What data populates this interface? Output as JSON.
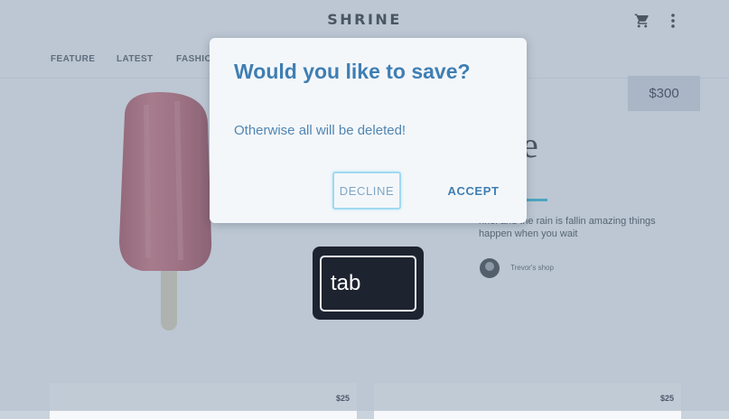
{
  "app": {
    "title": "SHRINE",
    "tabs": [
      "FEATURE",
      "LATEST",
      "FASHION"
    ]
  },
  "product": {
    "price": "$300",
    "title_glyph": "e",
    "description": "nnel and the rain is fallin amazing things happen when you wait",
    "shop_name": "Trevor's shop"
  },
  "cards": [
    {
      "price": "$25"
    },
    {
      "price": "$25"
    }
  ],
  "dialog": {
    "title": "Would you like to save?",
    "body": "Otherwise all will be deleted!",
    "decline_label": "DECLINE",
    "accept_label": "ACCEPT"
  },
  "key_overlay": {
    "label": "tab"
  },
  "icons": {
    "cart": "cart-icon",
    "more": "more-vert-icon"
  },
  "colors": {
    "accent": "#3f7fb3",
    "focus_ring": "#9fdaf1",
    "scrim": "#788ca5"
  }
}
